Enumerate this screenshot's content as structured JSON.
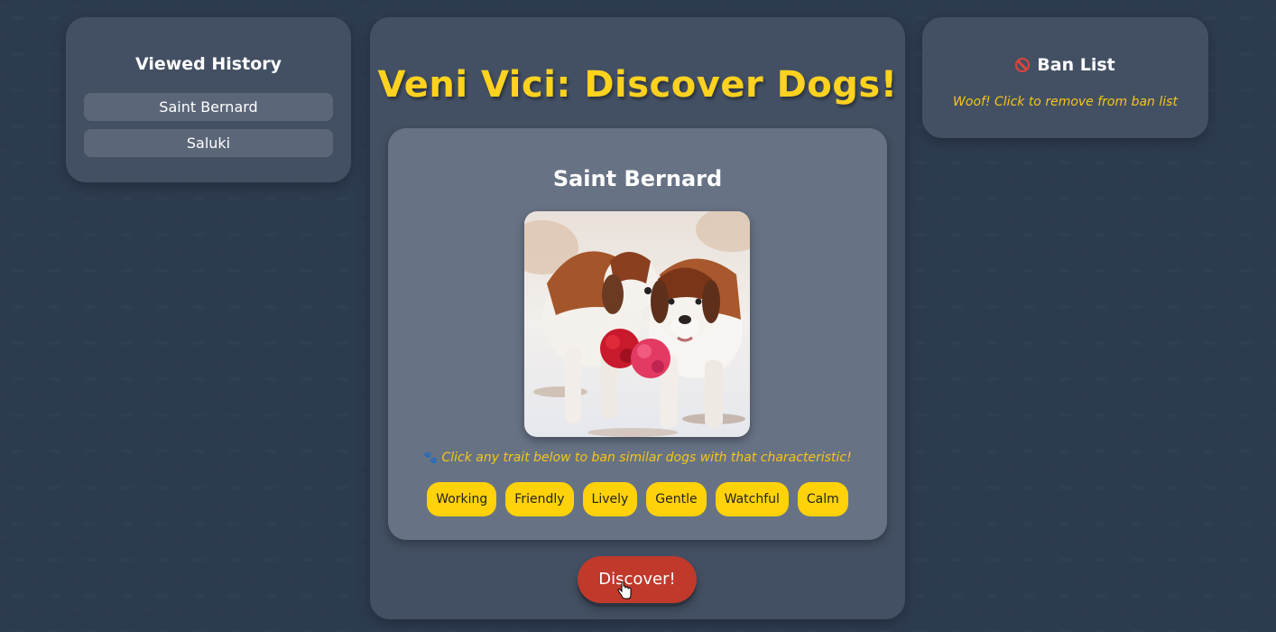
{
  "history": {
    "title": "Viewed History",
    "items": [
      "Saint Bernard",
      "Saluki"
    ]
  },
  "main": {
    "title": "Veni Vici: Discover Dogs!",
    "dog": {
      "name": "Saint Bernard",
      "image_alt": "Two Saint Bernard dogs in snow with red and pink flowers",
      "trait_hint": "Click any trait below to ban similar dogs with that characteristic!",
      "traits": [
        "Working",
        "Friendly",
        "Lively",
        "Gentle",
        "Watchful",
        "Calm"
      ]
    },
    "discover_label": "Discover!"
  },
  "ban": {
    "title": "Ban List",
    "hint": "Woof! Click to remove from ban list"
  },
  "colors": {
    "background": "#2d3b50",
    "panel": "#435063",
    "card": "#677385",
    "title_yellow": "#ffd21f",
    "trait_yellow": "#ffd20a",
    "discover_red": "#c0392b",
    "ban_red": "#e0443a"
  },
  "icons": [
    "ban-icon",
    "paw-icon",
    "pointer-cursor-icon"
  ]
}
